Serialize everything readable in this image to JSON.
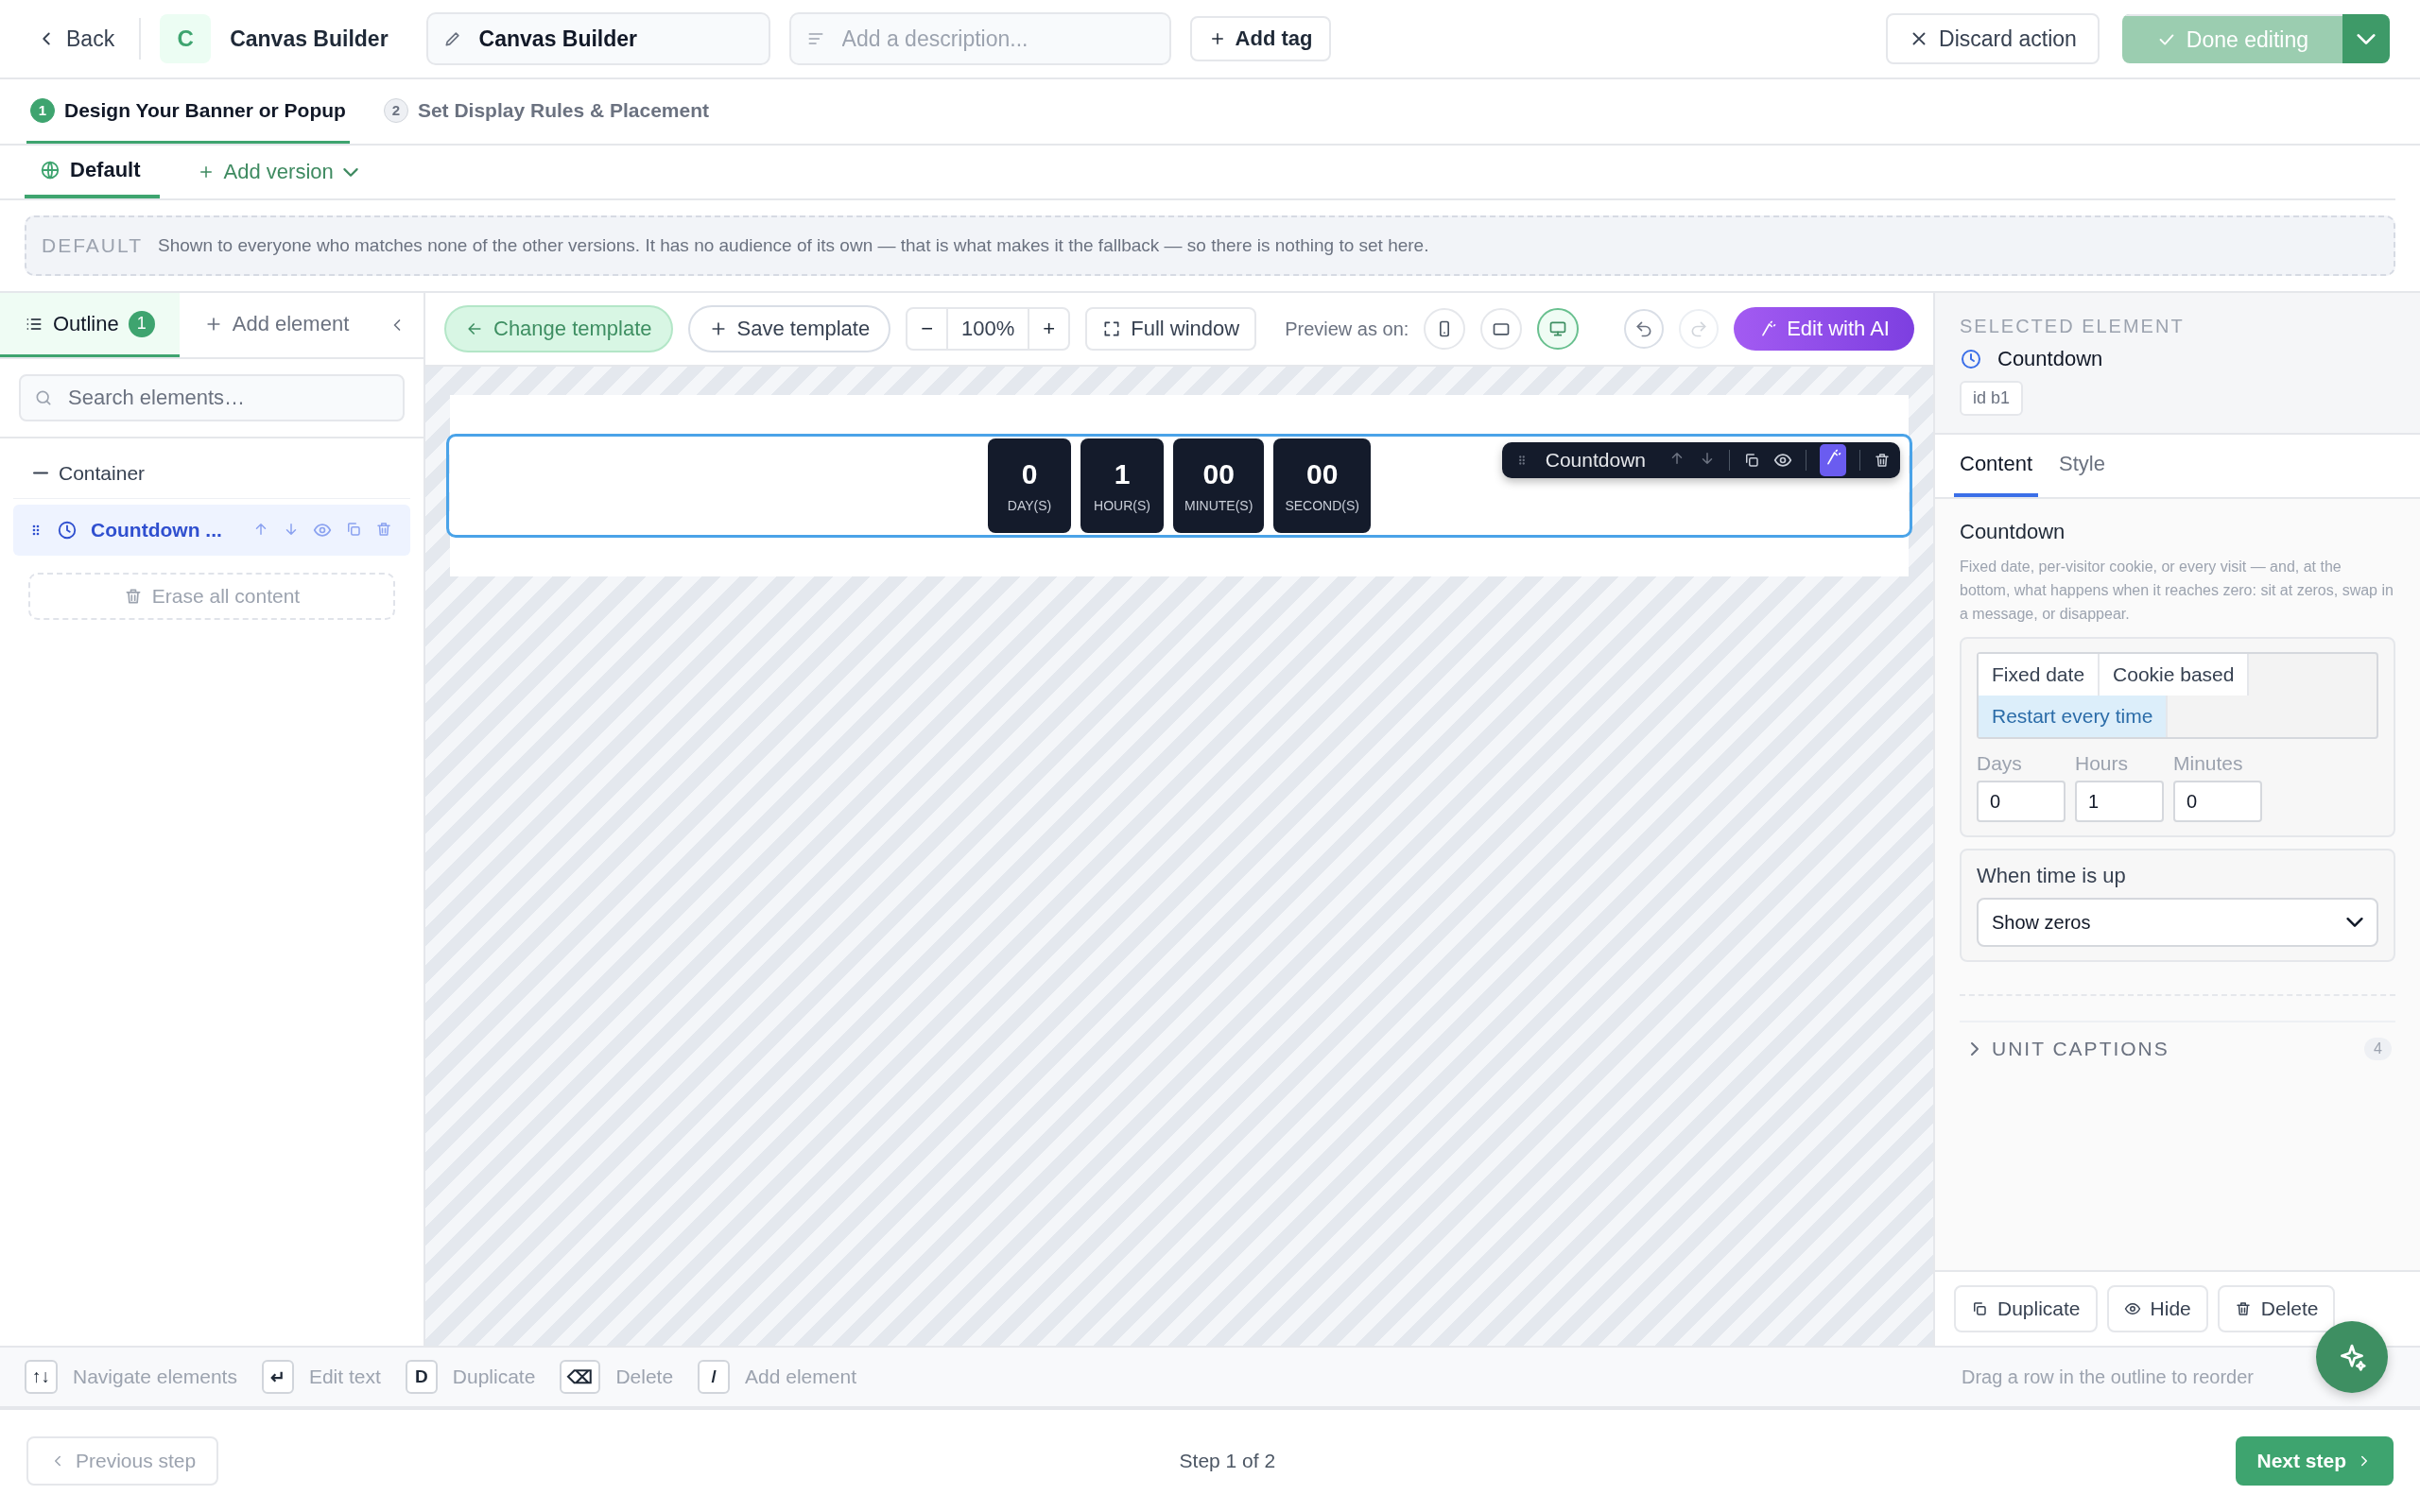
{
  "header": {
    "back": "Back",
    "logo_letter": "C",
    "app_name": "Canvas Builder",
    "name_field": {
      "value": "Canvas Builder"
    },
    "description_field": {
      "placeholder": "Add a description..."
    },
    "add_tag": "Add tag",
    "discard": "Discard action",
    "done": {
      "label": "Done editing",
      "disabled": true
    }
  },
  "steps": [
    {
      "number": "1",
      "label": "Design Your Banner or Popup",
      "selected": true
    },
    {
      "number": "2",
      "label": "Set Display Rules & Placement",
      "selected": false
    }
  ],
  "versions": [
    {
      "label": "Default",
      "selected": true
    }
  ],
  "add_version": "Add version",
  "notice": {
    "tag": "DEFAULT",
    "text": "Shown to everyone who matches none of the other versions. It has no audience of its own — that is what makes it the fallback — so there is nothing to set here."
  },
  "left_panel": {
    "tabs": [
      {
        "label": "Outline",
        "badge": "1",
        "selected": true
      },
      {
        "label": "Add element",
        "selected": false
      }
    ],
    "search": {
      "placeholder": "Search elements…"
    },
    "tree": [
      {
        "label": "Container",
        "expanded": true,
        "children": [
          {
            "label": "Countdown ...",
            "selected": true
          }
        ]
      }
    ],
    "erase": "Erase all content"
  },
  "toolbar": {
    "change_template": "Change template",
    "save_template": "Save template",
    "zoom": {
      "minus": "−",
      "value": "100%",
      "plus": "+"
    },
    "full_window": "Full window",
    "preview_label": "Preview as on:",
    "devices": [
      {
        "kind": "phone",
        "selected": false
      },
      {
        "kind": "tablet",
        "selected": false
      },
      {
        "kind": "desktop",
        "selected": true
      }
    ],
    "undo": {
      "disabled": false
    },
    "redo": {
      "disabled": true
    },
    "edit_ai": "Edit with AI"
  },
  "canvas": {
    "units": [
      {
        "value": "0",
        "caption": "DAY(S)"
      },
      {
        "value": "1",
        "caption": "HOUR(S)"
      },
      {
        "value": "00",
        "caption": "MINUTE(S)"
      },
      {
        "value": "00",
        "caption": "SECOND(S)"
      }
    ],
    "floating_toolbar": {
      "label": "Countdown"
    }
  },
  "right_panel": {
    "heading": "SELECTED ELEMENT",
    "element": "Countdown",
    "id_chip": "id b1",
    "tabs": [
      {
        "label": "Content",
        "selected": true
      },
      {
        "label": "Style",
        "selected": false
      }
    ],
    "section_title": "Countdown",
    "description": "Fixed date, per-visitor cookie, or every visit — and, at the bottom, what happens when it reaches zero: sit at zeros, swap in a message, or disappear.",
    "modes": [
      {
        "label": "Fixed date",
        "selected": false
      },
      {
        "label": "Cookie based",
        "selected": false
      },
      {
        "label": "Restart every time",
        "selected": true
      }
    ],
    "fields": [
      {
        "label": "Days",
        "value": "0"
      },
      {
        "label": "Hours",
        "value": "1"
      },
      {
        "label": "Minutes",
        "value": "0"
      }
    ],
    "time_up": {
      "label": "When time is up",
      "value": "Show zeros"
    },
    "unit_captions": {
      "label": "UNIT CAPTIONS",
      "count": "4",
      "expanded": false
    },
    "actions": [
      {
        "kind": "duplicate",
        "label": "Duplicate"
      },
      {
        "kind": "hide",
        "label": "Hide"
      },
      {
        "kind": "delete",
        "label": "Delete"
      }
    ]
  },
  "shortcuts": [
    {
      "key": "↑↓",
      "label": "Navigate elements"
    },
    {
      "key": "↵",
      "label": "Edit text"
    },
    {
      "key": "D",
      "label": "Duplicate"
    },
    {
      "key": "⌫",
      "label": "Delete"
    },
    {
      "key": "/",
      "label": "Add element"
    }
  ],
  "reorder_hint": "Drag a row in the outline to reorder",
  "footer": {
    "previous": "Previous step",
    "step": "Step 1 of 2",
    "next": "Next step"
  }
}
